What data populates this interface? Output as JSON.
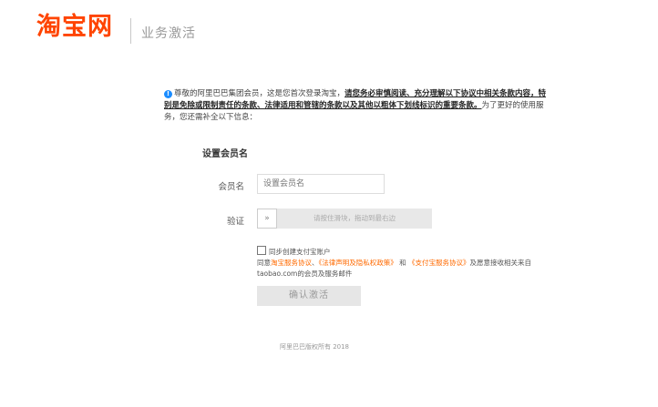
{
  "header": {
    "logo_text": "淘宝网",
    "title": "业务激活"
  },
  "notice": {
    "info_icon": "info-icon",
    "text_plain_1": "尊敬的阿里巴巴集团会员，这是您首次登录淘宝，",
    "text_bold": "请您务必审慎阅读、充分理解以下协议中相关条款内容，特别是免除或限制责任的条款、法律适用和管辖的条款以及其他以粗体下划线标识的重要条款。",
    "text_plain_2": "为了更好的使用服务，您还需补全以下信息："
  },
  "form": {
    "section_title": "设置会员名",
    "member_label": "会员名",
    "member_placeholder": "设置会员名",
    "verify_label": "验证",
    "slider_handle": "»",
    "slider_text": "请按住滑块，拖动到最右边"
  },
  "agreement": {
    "checkbox_label": "同步创建支付宝账户",
    "agree_prefix": "同意",
    "link_1": "淘宝服务协议",
    "sep_1": "、",
    "link_2": "《法律声明及隐私权政策》",
    "and_text": " 和 ",
    "link_3": "《支付宝服务协议》",
    "suffix": "及愿意接收相关来自taobao.com的会员及服务邮件"
  },
  "submit_label": "确认激活",
  "footer": "阿里巴巴版权所有 2018",
  "colors": {
    "brand": "#ff4400",
    "link": "#ff6a00",
    "info": "#1a8cff"
  }
}
